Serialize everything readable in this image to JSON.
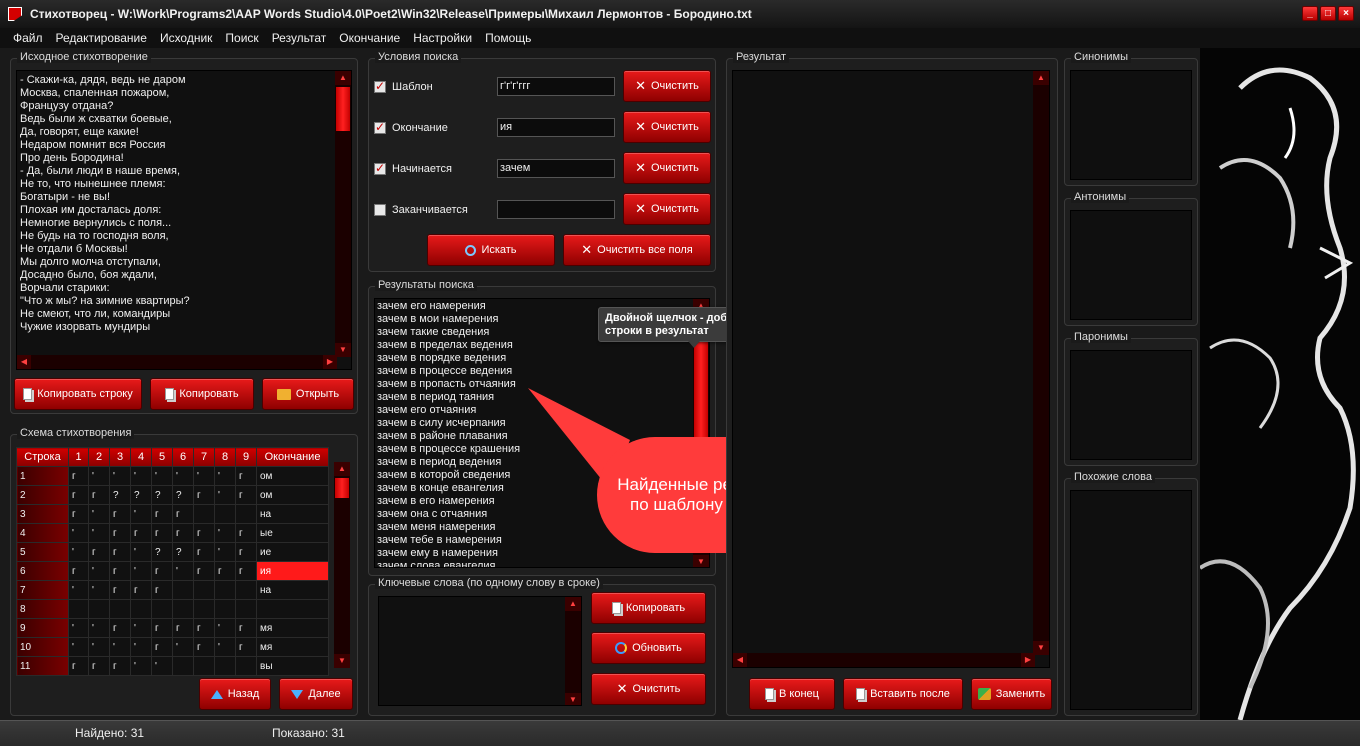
{
  "window": {
    "title": "Стихотворец - W:\\Work\\Programs2\\AAP Words Studio\\4.0\\Poet2\\Win32\\Release\\Примеры\\Михаил Лермонтов - Бородино.txt",
    "min": "_",
    "max": "□",
    "close": "×"
  },
  "menu": [
    "Файл",
    "Редактирование",
    "Исходник",
    "Поиск",
    "Результат",
    "Окончание",
    "Настройки",
    "Помощь"
  ],
  "source": {
    "title": "Исходное стихотворение",
    "lines": [
      "- Скажи-ка, дядя, ведь не даром",
      "Москва, спаленная пожаром,",
      "Французу отдана?",
      "Ведь были ж схватки боевые,",
      "Да, говорят, еще какие!",
      "Недаром помнит вся Россия",
      "Про день Бородина!",
      "",
      "- Да, были люди в наше время,",
      "Не то, что нынешнее племя:",
      "Богатыри - не вы!",
      "Плохая им досталась доля:",
      "Немногие вернулись с поля...",
      "Не будь на то господня воля,",
      "Не отдали б Москвы!",
      "",
      "Мы долго молча отступали,",
      "Досадно было, боя ждали,",
      "Ворчали старики:",
      "\"Что ж мы? на зимние квартиры?",
      "Не смеют, что ли, командиры",
      "Чужие изорвать мундиры"
    ],
    "btn_copy_line": "Копировать строку",
    "btn_copy": "Копировать",
    "btn_open": "Открыть"
  },
  "scheme": {
    "title": "Схема стихотворения",
    "headers": [
      "Строка",
      "1",
      "2",
      "3",
      "4",
      "5",
      "6",
      "7",
      "8",
      "9",
      "Окончание"
    ],
    "rows": [
      [
        "1",
        "г",
        "'",
        "'",
        "'",
        "'",
        "'",
        "'",
        "'",
        "г",
        "ом"
      ],
      [
        "2",
        "г",
        "г",
        "?",
        "?",
        "?",
        "?",
        "г",
        "'",
        "г",
        "ом"
      ],
      [
        "3",
        "г",
        "'",
        "г",
        "'",
        "г",
        "г",
        "",
        "",
        "",
        "на"
      ],
      [
        "4",
        "'",
        "'",
        "г",
        "г",
        "г",
        "г",
        "г",
        "'",
        "г",
        "ые"
      ],
      [
        "5",
        "'",
        "г",
        "г",
        "'",
        "?",
        "?",
        "г",
        "'",
        "г",
        "ие"
      ],
      [
        "6",
        "г",
        "'",
        "г",
        "'",
        "г",
        "'",
        "г",
        "г",
        "г",
        "ия"
      ],
      [
        "7",
        "'",
        "'",
        "г",
        "г",
        "г",
        "",
        "",
        "",
        "",
        "на"
      ],
      [
        "8",
        "",
        "",
        "",
        "",
        "",
        "",
        "",
        "",
        "",
        ""
      ],
      [
        "9",
        "'",
        "'",
        "г",
        "'",
        "г",
        "г",
        "г",
        "'",
        "г",
        "мя"
      ],
      [
        "10",
        "'",
        "'",
        "'",
        "'",
        "г",
        "'",
        "г",
        "'",
        "г",
        "мя"
      ],
      [
        "11",
        "г",
        "г",
        "г",
        "'",
        "'",
        "",
        "",
        "",
        "",
        "вы"
      ]
    ],
    "btn_back": "Назад",
    "btn_next": "Далее"
  },
  "conditions": {
    "title": "Условия поиска",
    "rows": [
      {
        "label": "Шаблон",
        "value": "г'г'г'ггг",
        "checked": true
      },
      {
        "label": "Окончание",
        "value": "ия",
        "checked": true
      },
      {
        "label": "Начинается",
        "value": "зачем",
        "checked": true
      },
      {
        "label": "Заканчивается",
        "value": "",
        "checked": false
      }
    ],
    "btn_clear": "Очистить",
    "btn_search": "Искать",
    "btn_clear_all": "Очистить все поля"
  },
  "search_results": {
    "title": "Результаты поиска",
    "items": [
      "зачем его намерения",
      "зачем в мои намерения",
      "зачем такие сведения",
      "зачем в пределах ведения",
      "зачем в порядке ведения",
      "зачем в процессе ведения",
      "зачем в пропасть отчаяния",
      "зачем в период таяния",
      "зачем его отчаяния",
      "зачем в силу исчерпания",
      "зачем в районе плавания",
      "зачем в процессе крашения",
      "зачем в период ведения",
      "зачем в которой сведения",
      "зачем в конце евангелия",
      "зачем в его намерения",
      "зачем она с отчаяния",
      "зачем меня намерения",
      "зачем тебе в намерения",
      "зачем ему в намерения",
      "зачем слова евангелия"
    ],
    "tooltip": "Двойной щелчок - добавление строки в результат",
    "callout": "Найденные результаты, созвучные по шаблону с исходной строкой"
  },
  "keywords": {
    "title": "Ключевые слова (по одному слову в сроке)",
    "btn_copy": "Копировать",
    "btn_refresh": "Обновить",
    "btn_clear": "Очистить"
  },
  "result": {
    "title": "Результат",
    "btn_to_end": "В конец",
    "btn_insert_after": "Вставить после",
    "btn_replace": "Заменить"
  },
  "side": {
    "synonyms": "Синонимы",
    "antonyms": "Антонимы",
    "paronyms": "Паронимы",
    "similar": "Похожие слова"
  },
  "status": {
    "found": "Найдено: 31",
    "shown": "Показано: 31"
  },
  "colors": {
    "accent": "#d40000",
    "callout": "#ff3b3b",
    "selected_cell": "#ff1a1a"
  }
}
